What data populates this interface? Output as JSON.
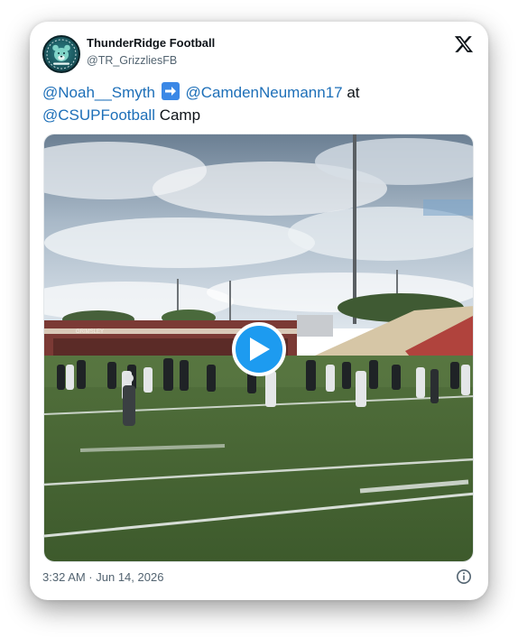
{
  "account": {
    "name": "ThunderRidge Football",
    "handle": "@TR_GrizzliesFB"
  },
  "tweet": {
    "mention_from": "@Noah__Smyth",
    "arrow": "right-arrow-emoji",
    "mention_to": "@CamdenNeumann17",
    "word_at": "at",
    "mention_org": "@CSUPFootball",
    "word_camp": "Camp"
  },
  "media": {
    "type": "video",
    "scene_sign": "GRIMSLEY",
    "play_icon": "play-icon"
  },
  "footer": {
    "timestamp": "3:32 AM · Jun 14, 2026",
    "info_icon": "info-icon"
  },
  "brand": {
    "logo_icon": "x-logo-icon",
    "link_color": "#1d6fb8",
    "play_color": "#1d9bf0"
  }
}
